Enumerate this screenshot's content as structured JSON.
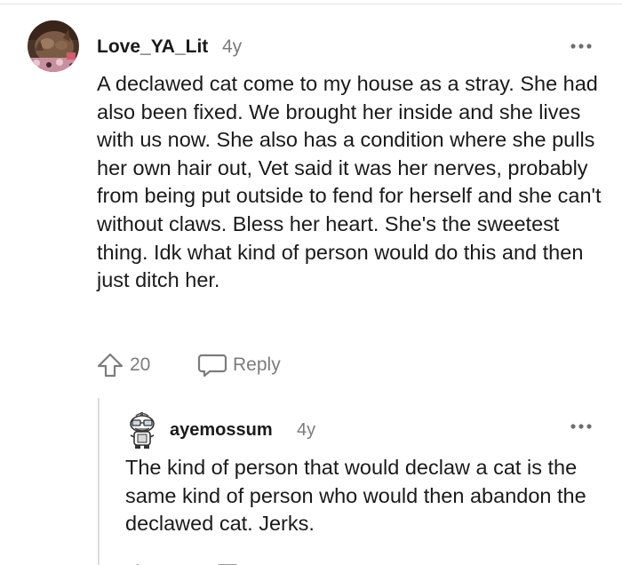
{
  "comment": {
    "username": "Love_YA_Lit",
    "age": "4y",
    "more_icon": "more-horizontal-icon",
    "text": "A declawed cat come to my house as a stray. She had also been fixed. We brought her inside and she lives with us now. She also has a condition where she pulls her own hair out, Vet said it was her nerves, probably from being put outside to fend for herself and she can't without claws. Bless her heart. She's the sweetest thing. Idk what kind of person would do this and then just ditch her.",
    "upvote_icon": "upvote-arrow-icon",
    "vote_count": "20",
    "reply_icon": "speech-bubble-icon",
    "reply_label": "Reply"
  },
  "reply": {
    "username": "ayemossum",
    "age": "4y",
    "more_icon": "more-horizontal-icon",
    "text": "The kind of person that would declaw a cat is the same kind of person who would then abandon the declawed cat. Jerks."
  },
  "colors": {
    "text": "#1a1a1b",
    "meta": "#7c7c7c",
    "thread_line": "#dcdcdc"
  }
}
